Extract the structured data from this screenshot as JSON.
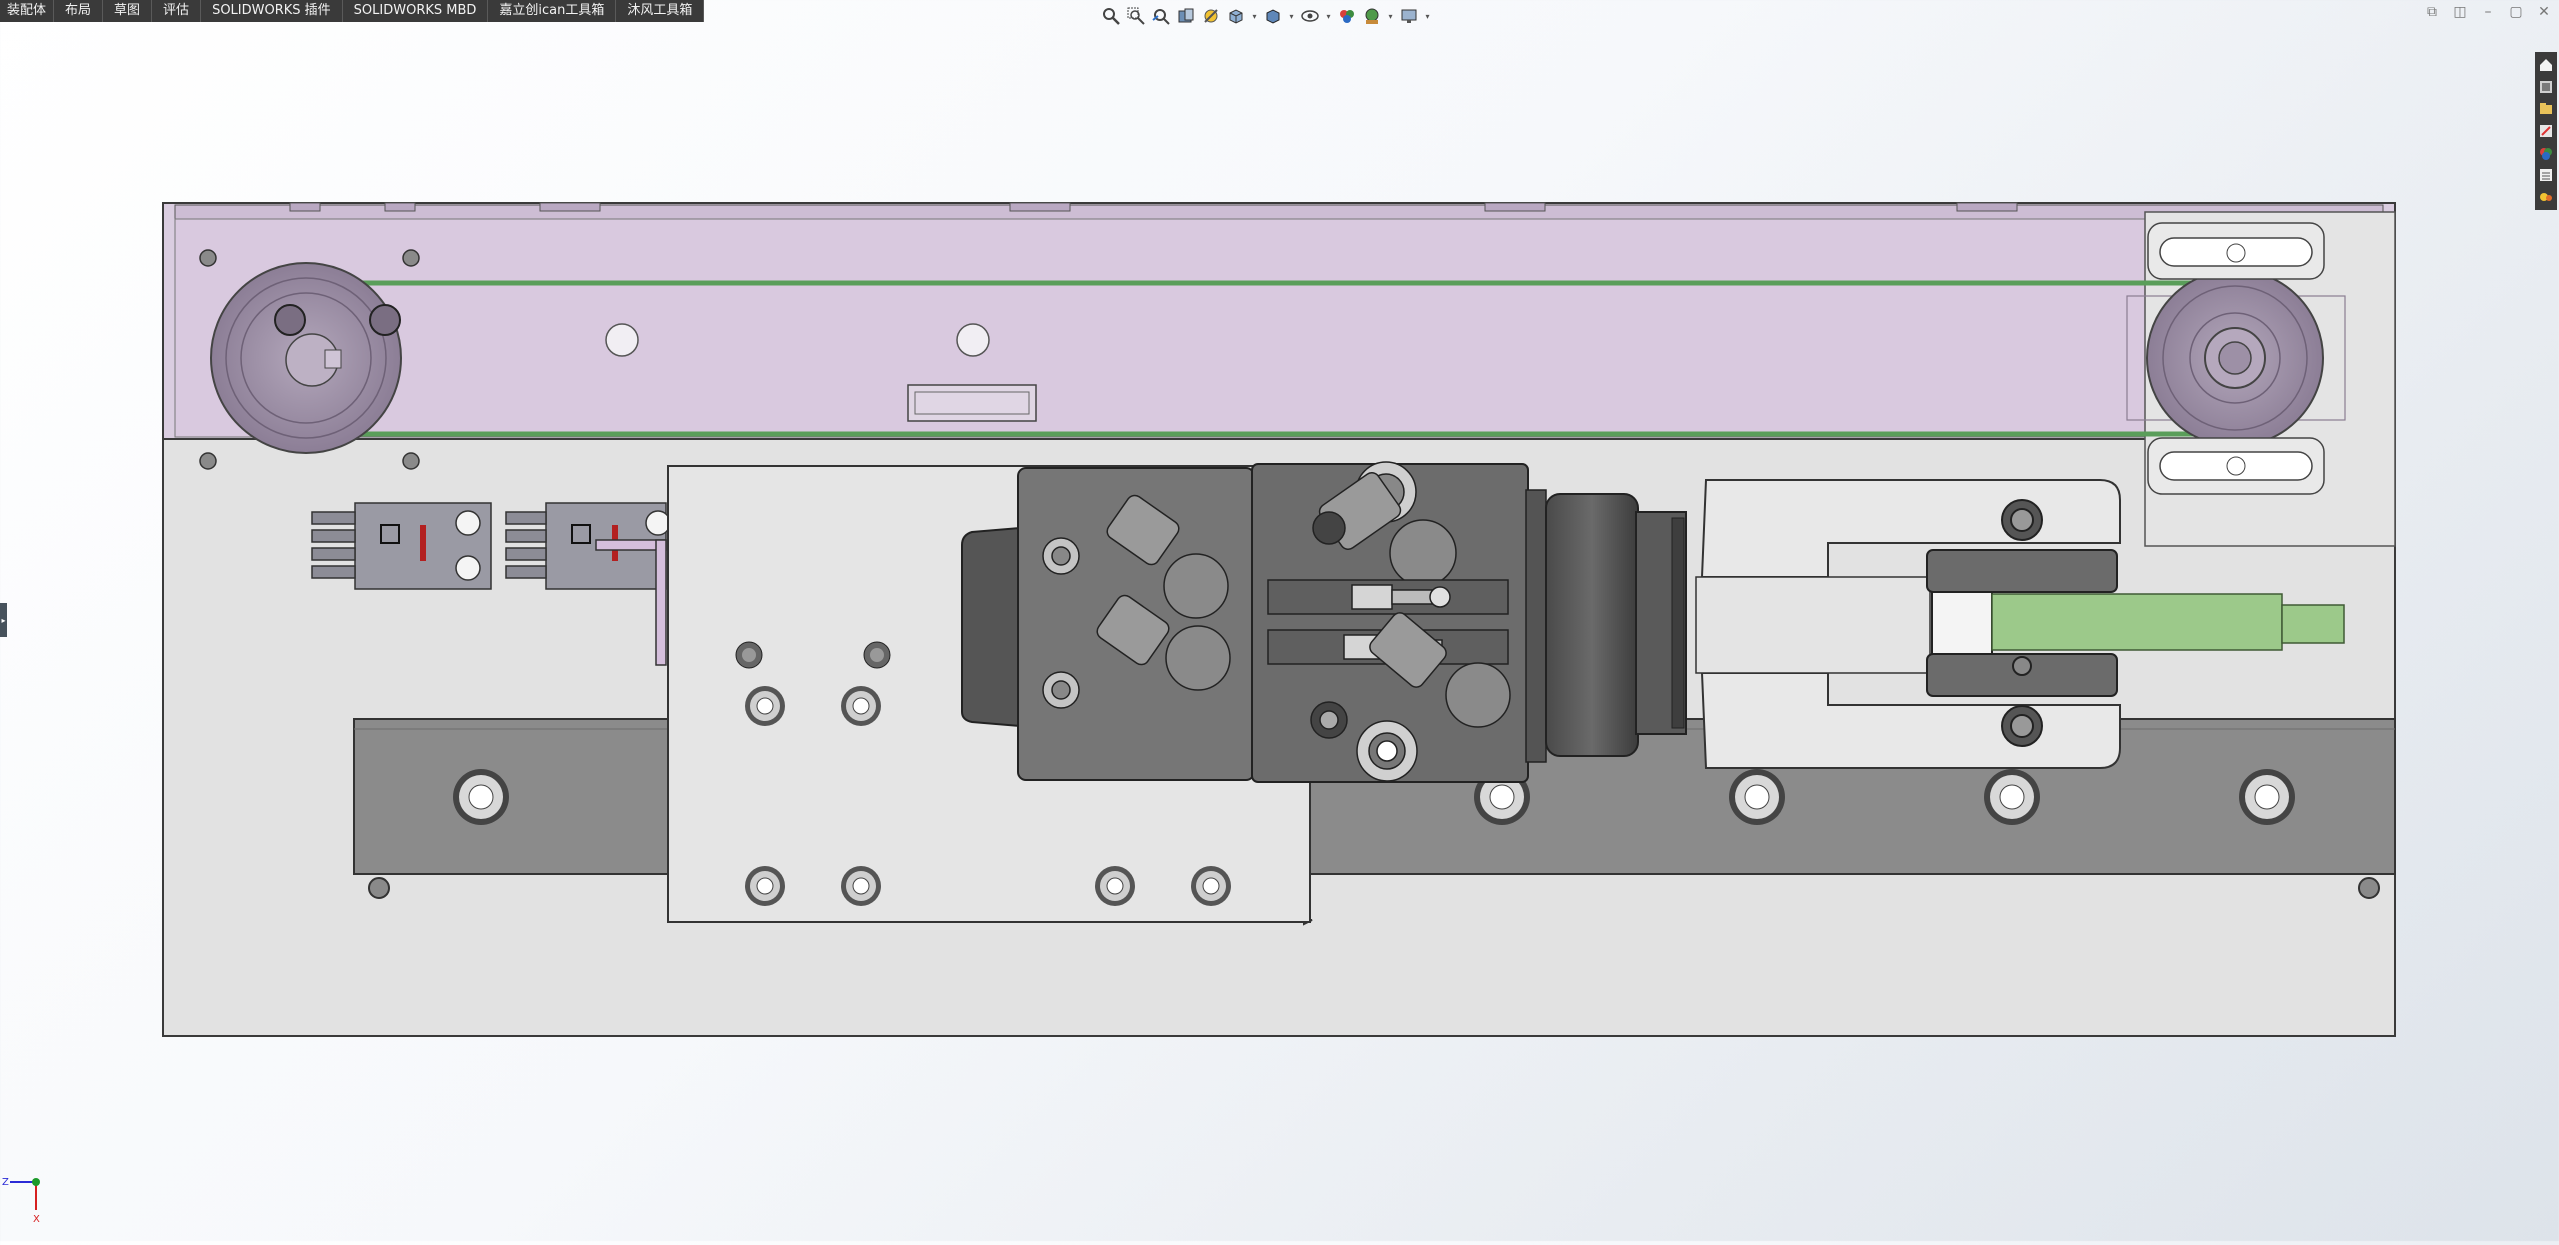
{
  "menu_tabs": [
    "装配体",
    "布局",
    "草图",
    "评估",
    "SOLIDWORKS 插件",
    "SOLIDWORKS MBD",
    "嘉立创ican工具箱",
    "沐风工具箱"
  ],
  "view_toolbar_icons": [
    "zoom-to-fit-icon",
    "zoom-to-area-icon",
    "previous-view-icon",
    "section-view-icon",
    "dynamic-annotation-icon",
    "view-orientation-icon",
    "display-style-icon",
    "hide-show-items-icon",
    "edit-appearance-icon",
    "apply-scene-icon",
    "view-settings-icon"
  ],
  "window_controls": [
    "restore-down-icon",
    "tile-icon",
    "minimize-icon",
    "maximize-icon",
    "close-icon"
  ],
  "task_pane_icons": [
    "home-icon",
    "design-library-icon",
    "file-explorer-icon",
    "view-palette-icon",
    "appearances-icon",
    "custom-properties-icon",
    "solidworks-forum-icon"
  ],
  "triad": {
    "axis_labels": [
      "Z",
      "X"
    ]
  },
  "colors": {
    "menu_bg": "#3a3a3a",
    "plate": "#e1e1e1",
    "rail": "#8b8b8b",
    "purple_housing": "#d8c8de",
    "pulley": "#9d8fa6",
    "belt": "#5a9e5a",
    "cylinder_body": "#6f6f6f",
    "green_bar": "#9cc98a",
    "edge": "#2a2a2a",
    "triad_x": "#d62020",
    "triad_z": "#2b2bd6",
    "triad_y": "#1c9a2a"
  }
}
